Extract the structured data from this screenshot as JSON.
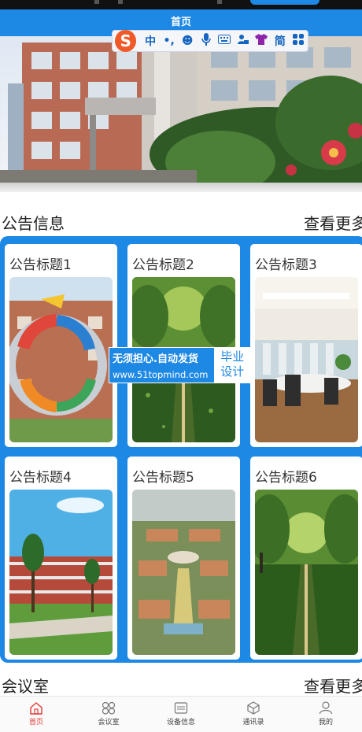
{
  "header": {
    "title": "首页"
  },
  "ime_toolbar": {
    "logo": "S",
    "items": [
      {
        "icon": "chinese-mode-icon",
        "glyph": "中"
      },
      {
        "icon": "punctuation-icon",
        "glyph": "•,"
      },
      {
        "icon": "emoji-icon",
        "glyph": "☻"
      },
      {
        "icon": "microphone-icon",
        "glyph": "🎙"
      },
      {
        "icon": "keyboard-icon",
        "glyph": "⌨"
      },
      {
        "icon": "user-lock-icon",
        "glyph": "♙"
      },
      {
        "icon": "skin-shirt-icon",
        "glyph": "👕"
      },
      {
        "icon": "simplified-icon",
        "glyph": "简"
      },
      {
        "icon": "grid-menu-icon",
        "glyph": "✣"
      }
    ]
  },
  "notice": {
    "title": "公告信息",
    "more": "查看更多",
    "cards": [
      {
        "title": "公告标题1"
      },
      {
        "title": "公告标题2"
      },
      {
        "title": "公告标题3"
      },
      {
        "title": "公告标题4"
      },
      {
        "title": "公告标题5"
      },
      {
        "title": "公告标题6"
      }
    ]
  },
  "watermark": {
    "line1": "无须担心.自动发货",
    "line2": "www.51topmind.com",
    "right_line1": "毕业",
    "right_line2": "设计"
  },
  "meeting": {
    "title": "会议室",
    "more": "查看更多"
  },
  "tabbar": {
    "items": [
      {
        "label": "首页",
        "icon": "home-icon",
        "active": true
      },
      {
        "label": "会议室",
        "icon": "meeting-room-icon",
        "active": false
      },
      {
        "label": "设备信息",
        "icon": "device-icon",
        "active": false
      },
      {
        "label": "通讯录",
        "icon": "contacts-icon",
        "active": false
      },
      {
        "label": "我的",
        "icon": "profile-icon",
        "active": false
      }
    ]
  },
  "colors": {
    "primary": "#1e88e5",
    "active_tab": "#e53935"
  }
}
